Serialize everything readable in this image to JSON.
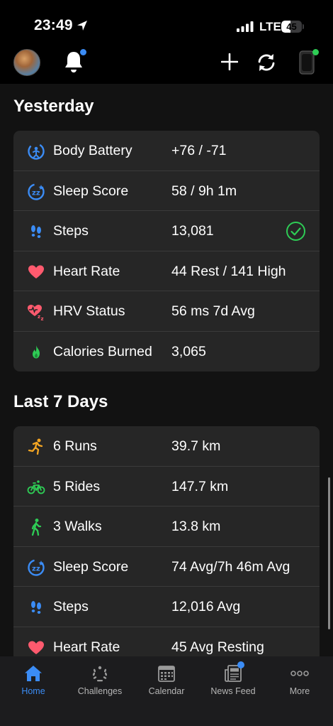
{
  "status_bar": {
    "time": "23:49",
    "network": "LTE",
    "battery": "45",
    "battery_level": 0.45
  },
  "header": {
    "avatar": "profile-avatar",
    "icons": [
      "bell-icon",
      "plus-icon",
      "sync-icon",
      "watch-icon"
    ]
  },
  "colors": {
    "accent": "#3b8cf5",
    "notification_dot": "#3b8cf5",
    "device_connected": "#2ecc55",
    "card_bg": "#262626",
    "check_green": "#2ecc55"
  },
  "yesterday": {
    "title": "Yesterday",
    "rows": [
      {
        "icon": "body-battery-icon",
        "label": "Body Battery",
        "value": "+76 / -71"
      },
      {
        "icon": "sleep-score-icon",
        "label": "Sleep Score",
        "value": "58 / 9h 1m"
      },
      {
        "icon": "steps-icon",
        "label": "Steps",
        "value": "13,081",
        "goal_met": true
      },
      {
        "icon": "heart-rate-icon",
        "label": "Heart Rate",
        "value": "44 Rest / 141 High"
      },
      {
        "icon": "hrv-status-icon",
        "label": "HRV Status",
        "value": "56 ms 7d Avg"
      },
      {
        "icon": "calories-flame-icon",
        "label": "Calories Burned",
        "value": "3,065"
      }
    ]
  },
  "last7": {
    "title": "Last 7 Days",
    "rows": [
      {
        "icon": "run-icon",
        "label": "6 Runs",
        "value": "39.7 km"
      },
      {
        "icon": "bike-icon",
        "label": "5 Rides",
        "value": "147.7 km"
      },
      {
        "icon": "walk-icon",
        "label": "3 Walks",
        "value": "13.8 km"
      },
      {
        "icon": "sleep-score-icon",
        "label": "Sleep Score",
        "value": "74 Avg/7h 46m Avg"
      },
      {
        "icon": "steps-icon",
        "label": "Steps",
        "value": "12,016 Avg"
      },
      {
        "icon": "heart-rate-icon",
        "label": "Heart Rate",
        "value": "45 Avg Resting"
      }
    ]
  },
  "tabs": [
    {
      "label": "Home",
      "icon": "home-icon",
      "active": true
    },
    {
      "label": "Challenges",
      "icon": "laurel-icon",
      "active": false
    },
    {
      "label": "Calendar",
      "icon": "calendar-icon",
      "active": false
    },
    {
      "label": "News Feed",
      "icon": "newspaper-icon",
      "active": false
    },
    {
      "label": "More",
      "icon": "more-dots-icon",
      "active": false
    }
  ]
}
